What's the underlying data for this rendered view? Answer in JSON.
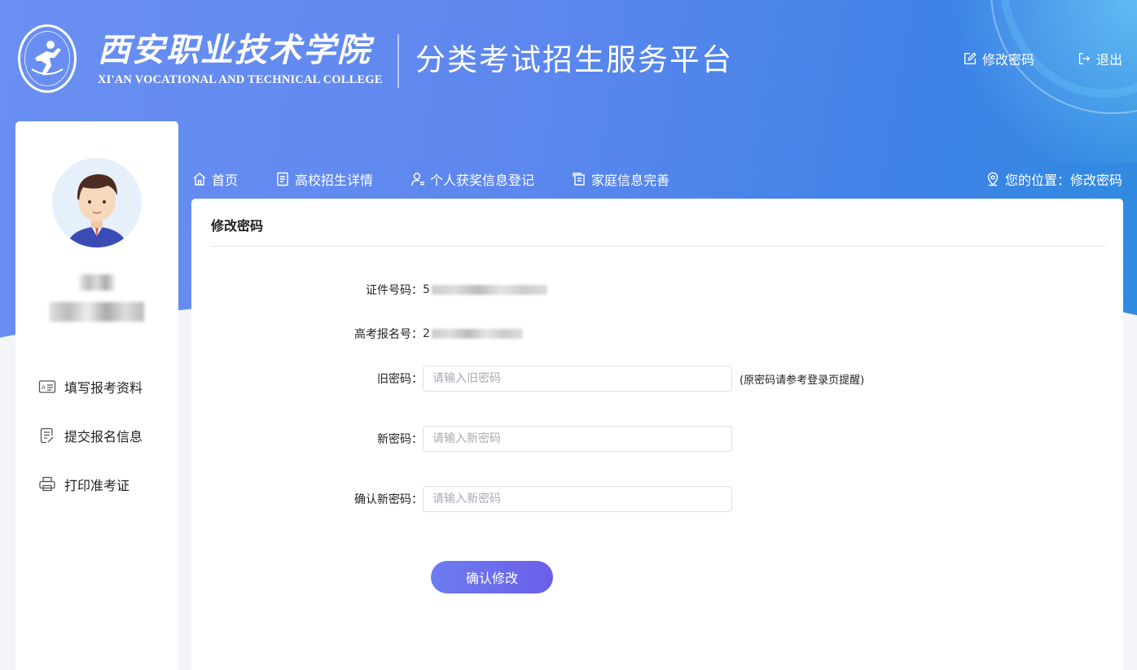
{
  "header": {
    "college_cn": "西安职业技术学院",
    "college_en": "XI'AN VOCATIONAL AND TECHNICAL COLLEGE",
    "platform_title": "分类考试招生服务平台",
    "actions": {
      "change_password": "修改密码",
      "logout": "退出"
    }
  },
  "sidebar": {
    "items": [
      {
        "label": "填写报考资料",
        "icon": "id-card-icon"
      },
      {
        "label": "提交报名信息",
        "icon": "document-edit-icon"
      },
      {
        "label": "打印准考证",
        "icon": "printer-icon"
      }
    ]
  },
  "nav": {
    "items": [
      {
        "label": "首页",
        "icon": "home-icon"
      },
      {
        "label": "高校招生详情",
        "icon": "document-icon"
      },
      {
        "label": "个人获奖信息登记",
        "icon": "user-award-icon"
      },
      {
        "label": "家庭信息完善",
        "icon": "family-info-icon"
      }
    ],
    "location": "您的位置：修改密码"
  },
  "main": {
    "title": "修改密码",
    "fields": {
      "id_label": "证件号码：",
      "id_value_prefix": "5",
      "exam_label": "高考报名号：",
      "exam_value_prefix": "2",
      "old_label": "旧密码：",
      "old_placeholder": "请输入旧密码",
      "old_hint": "(原密码请参考登录页提醒)",
      "new_label": "新密码：",
      "new_placeholder": "请输入新密码",
      "confirm_label": "确认新密码：",
      "confirm_placeholder": "请输入新密码"
    },
    "submit_label": "确认修改"
  },
  "colors": {
    "banner_start": "#6a8ff2",
    "banner_end": "#2f8cdf",
    "button_start": "#6d7cf0",
    "button_end": "#6a5fe8"
  }
}
